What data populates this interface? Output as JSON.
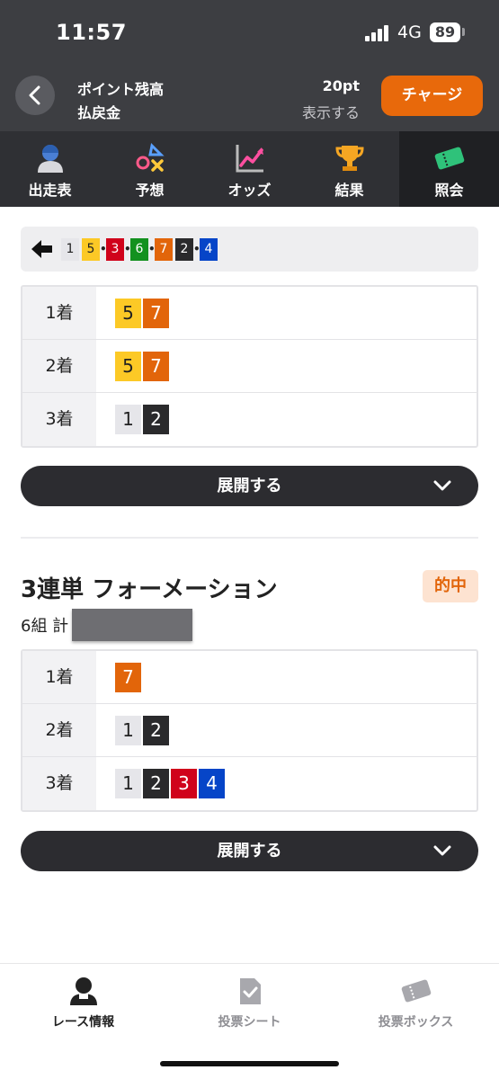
{
  "status": {
    "time": "11:57",
    "network": "4G",
    "battery": "89"
  },
  "header": {
    "points_label": "ポイント残高",
    "refund_label": "払戻金",
    "points_value": "20pt",
    "show_label": "表示する",
    "charge_label": "チャージ"
  },
  "tabs": [
    {
      "label": "出走表",
      "icon": "racer-icon"
    },
    {
      "label": "予想",
      "icon": "prediction-icon"
    },
    {
      "label": "オッズ",
      "icon": "odds-chart-icon"
    },
    {
      "label": "結果",
      "icon": "trophy-icon"
    },
    {
      "label": "照会",
      "icon": "ticket-icon",
      "active": true
    }
  ],
  "sequence": [
    "1",
    "5",
    "3",
    "6",
    "7",
    "2",
    "4"
  ],
  "ticket1": {
    "rows": [
      {
        "label": "1着",
        "numbers": [
          "5",
          "7"
        ]
      },
      {
        "label": "2着",
        "numbers": [
          "5",
          "7"
        ]
      },
      {
        "label": "3着",
        "numbers": [
          "1",
          "2"
        ]
      }
    ],
    "expand_label": "展開する"
  },
  "ticket2": {
    "title": "3連単 フォーメーション",
    "badge": "的中",
    "combo_text": "6組 計",
    "rows": [
      {
        "label": "1着",
        "numbers": [
          "7"
        ]
      },
      {
        "label": "2着",
        "numbers": [
          "1",
          "2"
        ]
      },
      {
        "label": "3着",
        "numbers": [
          "1",
          "2",
          "3",
          "4"
        ]
      }
    ],
    "expand_label": "展開する"
  },
  "bottom_nav": [
    {
      "label": "レース情報",
      "icon": "racer-icon",
      "color": "#222222"
    },
    {
      "label": "投票シート",
      "icon": "check-sheet-icon",
      "color": "#8e8e93"
    },
    {
      "label": "投票ボックス",
      "icon": "ticket-box-icon",
      "color": "#8e8e93"
    }
  ],
  "colors": {
    "accent": "#e8690b",
    "header_bg": "#3d3e42",
    "hit_badge_bg": "#fde3d1"
  }
}
